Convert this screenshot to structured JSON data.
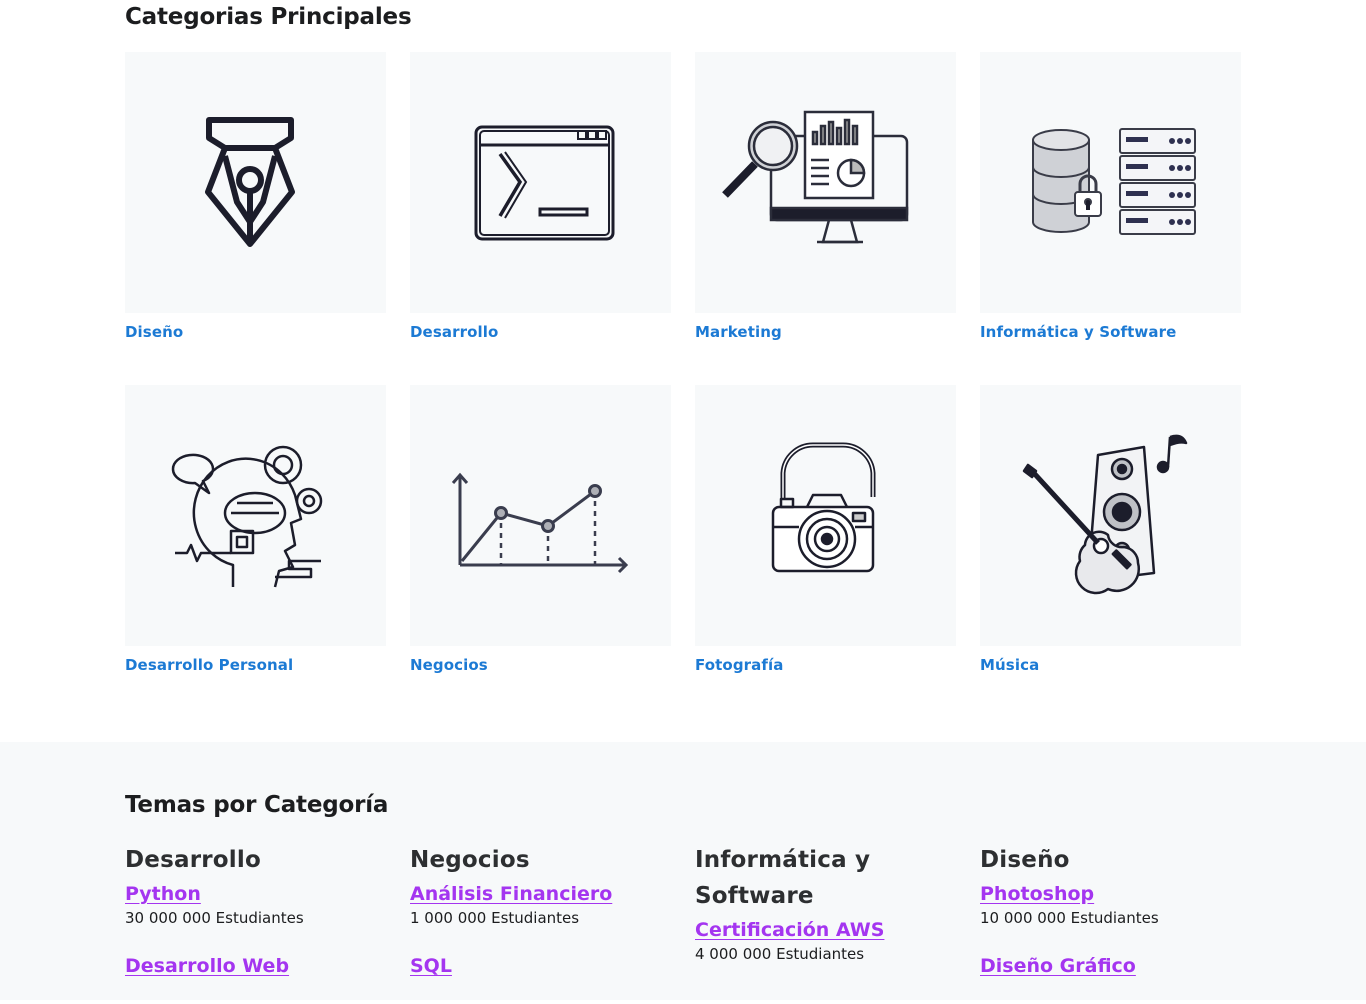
{
  "main_title": "Categorias Principales",
  "categories": [
    {
      "label": "Diseño",
      "icon": "pen-nib-icon"
    },
    {
      "label": "Desarrollo",
      "icon": "terminal-window-icon"
    },
    {
      "label": "Marketing",
      "icon": "analytics-monitor-icon"
    },
    {
      "label": "Informática y Software",
      "icon": "database-server-icon"
    },
    {
      "label": "Desarrollo Personal",
      "icon": "mind-gears-icon"
    },
    {
      "label": "Negocios",
      "icon": "line-chart-icon"
    },
    {
      "label": "Fotografía",
      "icon": "camera-icon"
    },
    {
      "label": "Música",
      "icon": "guitar-speaker-icon"
    }
  ],
  "topics_title": "Temas por Categoría",
  "topic_columns": [
    {
      "heading": "Desarrollo",
      "items": [
        {
          "name": "Python",
          "count": "30 000 000 Estudiantes"
        },
        {
          "name": "Desarrollo Web",
          "count": ""
        }
      ]
    },
    {
      "heading": "Negocios",
      "items": [
        {
          "name": "Análisis Financiero",
          "count": "1 000 000 Estudiantes"
        },
        {
          "name": "SQL",
          "count": ""
        }
      ]
    },
    {
      "heading": "Informática y Software",
      "items": [
        {
          "name": "Certificación AWS",
          "count": "4 000 000 Estudiantes"
        }
      ]
    },
    {
      "heading": "Diseño",
      "items": [
        {
          "name": "Photoshop",
          "count": "10 000 000 Estudiantes"
        },
        {
          "name": "Diseño Gráfico",
          "count": ""
        }
      ]
    }
  ],
  "colors": {
    "link_blue": "#1c7ad4",
    "topic_purple": "#a435f0",
    "card_bg": "#f7f9fa"
  }
}
